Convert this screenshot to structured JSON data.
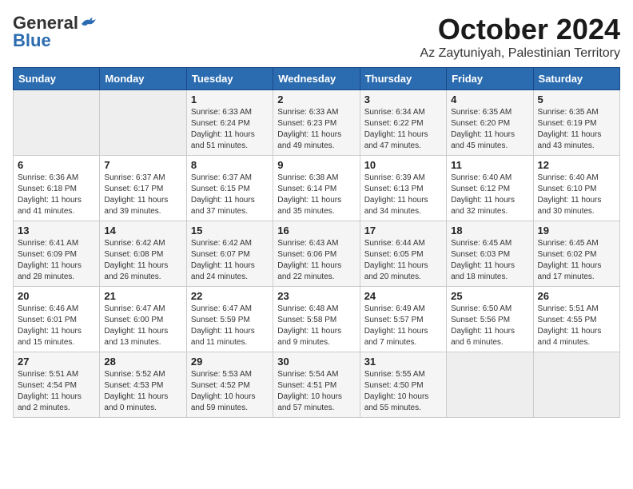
{
  "logo": {
    "general": "General",
    "blue": "Blue"
  },
  "title": "October 2024",
  "location": "Az Zaytuniyah, Palestinian Territory",
  "days_of_week": [
    "Sunday",
    "Monday",
    "Tuesday",
    "Wednesday",
    "Thursday",
    "Friday",
    "Saturday"
  ],
  "weeks": [
    [
      {
        "day": "",
        "empty": true
      },
      {
        "day": "",
        "empty": true
      },
      {
        "day": "1",
        "sunrise": "Sunrise: 6:33 AM",
        "sunset": "Sunset: 6:24 PM",
        "daylight": "Daylight: 11 hours and 51 minutes."
      },
      {
        "day": "2",
        "sunrise": "Sunrise: 6:33 AM",
        "sunset": "Sunset: 6:23 PM",
        "daylight": "Daylight: 11 hours and 49 minutes."
      },
      {
        "day": "3",
        "sunrise": "Sunrise: 6:34 AM",
        "sunset": "Sunset: 6:22 PM",
        "daylight": "Daylight: 11 hours and 47 minutes."
      },
      {
        "day": "4",
        "sunrise": "Sunrise: 6:35 AM",
        "sunset": "Sunset: 6:20 PM",
        "daylight": "Daylight: 11 hours and 45 minutes."
      },
      {
        "day": "5",
        "sunrise": "Sunrise: 6:35 AM",
        "sunset": "Sunset: 6:19 PM",
        "daylight": "Daylight: 11 hours and 43 minutes."
      }
    ],
    [
      {
        "day": "6",
        "sunrise": "Sunrise: 6:36 AM",
        "sunset": "Sunset: 6:18 PM",
        "daylight": "Daylight: 11 hours and 41 minutes."
      },
      {
        "day": "7",
        "sunrise": "Sunrise: 6:37 AM",
        "sunset": "Sunset: 6:17 PM",
        "daylight": "Daylight: 11 hours and 39 minutes."
      },
      {
        "day": "8",
        "sunrise": "Sunrise: 6:37 AM",
        "sunset": "Sunset: 6:15 PM",
        "daylight": "Daylight: 11 hours and 37 minutes."
      },
      {
        "day": "9",
        "sunrise": "Sunrise: 6:38 AM",
        "sunset": "Sunset: 6:14 PM",
        "daylight": "Daylight: 11 hours and 35 minutes."
      },
      {
        "day": "10",
        "sunrise": "Sunrise: 6:39 AM",
        "sunset": "Sunset: 6:13 PM",
        "daylight": "Daylight: 11 hours and 34 minutes."
      },
      {
        "day": "11",
        "sunrise": "Sunrise: 6:40 AM",
        "sunset": "Sunset: 6:12 PM",
        "daylight": "Daylight: 11 hours and 32 minutes."
      },
      {
        "day": "12",
        "sunrise": "Sunrise: 6:40 AM",
        "sunset": "Sunset: 6:10 PM",
        "daylight": "Daylight: 11 hours and 30 minutes."
      }
    ],
    [
      {
        "day": "13",
        "sunrise": "Sunrise: 6:41 AM",
        "sunset": "Sunset: 6:09 PM",
        "daylight": "Daylight: 11 hours and 28 minutes."
      },
      {
        "day": "14",
        "sunrise": "Sunrise: 6:42 AM",
        "sunset": "Sunset: 6:08 PM",
        "daylight": "Daylight: 11 hours and 26 minutes."
      },
      {
        "day": "15",
        "sunrise": "Sunrise: 6:42 AM",
        "sunset": "Sunset: 6:07 PM",
        "daylight": "Daylight: 11 hours and 24 minutes."
      },
      {
        "day": "16",
        "sunrise": "Sunrise: 6:43 AM",
        "sunset": "Sunset: 6:06 PM",
        "daylight": "Daylight: 11 hours and 22 minutes."
      },
      {
        "day": "17",
        "sunrise": "Sunrise: 6:44 AM",
        "sunset": "Sunset: 6:05 PM",
        "daylight": "Daylight: 11 hours and 20 minutes."
      },
      {
        "day": "18",
        "sunrise": "Sunrise: 6:45 AM",
        "sunset": "Sunset: 6:03 PM",
        "daylight": "Daylight: 11 hours and 18 minutes."
      },
      {
        "day": "19",
        "sunrise": "Sunrise: 6:45 AM",
        "sunset": "Sunset: 6:02 PM",
        "daylight": "Daylight: 11 hours and 17 minutes."
      }
    ],
    [
      {
        "day": "20",
        "sunrise": "Sunrise: 6:46 AM",
        "sunset": "Sunset: 6:01 PM",
        "daylight": "Daylight: 11 hours and 15 minutes."
      },
      {
        "day": "21",
        "sunrise": "Sunrise: 6:47 AM",
        "sunset": "Sunset: 6:00 PM",
        "daylight": "Daylight: 11 hours and 13 minutes."
      },
      {
        "day": "22",
        "sunrise": "Sunrise: 6:47 AM",
        "sunset": "Sunset: 5:59 PM",
        "daylight": "Daylight: 11 hours and 11 minutes."
      },
      {
        "day": "23",
        "sunrise": "Sunrise: 6:48 AM",
        "sunset": "Sunset: 5:58 PM",
        "daylight": "Daylight: 11 hours and 9 minutes."
      },
      {
        "day": "24",
        "sunrise": "Sunrise: 6:49 AM",
        "sunset": "Sunset: 5:57 PM",
        "daylight": "Daylight: 11 hours and 7 minutes."
      },
      {
        "day": "25",
        "sunrise": "Sunrise: 6:50 AM",
        "sunset": "Sunset: 5:56 PM",
        "daylight": "Daylight: 11 hours and 6 minutes."
      },
      {
        "day": "26",
        "sunrise": "Sunrise: 5:51 AM",
        "sunset": "Sunset: 4:55 PM",
        "daylight": "Daylight: 11 hours and 4 minutes."
      }
    ],
    [
      {
        "day": "27",
        "sunrise": "Sunrise: 5:51 AM",
        "sunset": "Sunset: 4:54 PM",
        "daylight": "Daylight: 11 hours and 2 minutes."
      },
      {
        "day": "28",
        "sunrise": "Sunrise: 5:52 AM",
        "sunset": "Sunset: 4:53 PM",
        "daylight": "Daylight: 11 hours and 0 minutes."
      },
      {
        "day": "29",
        "sunrise": "Sunrise: 5:53 AM",
        "sunset": "Sunset: 4:52 PM",
        "daylight": "Daylight: 10 hours and 59 minutes."
      },
      {
        "day": "30",
        "sunrise": "Sunrise: 5:54 AM",
        "sunset": "Sunset: 4:51 PM",
        "daylight": "Daylight: 10 hours and 57 minutes."
      },
      {
        "day": "31",
        "sunrise": "Sunrise: 5:55 AM",
        "sunset": "Sunset: 4:50 PM",
        "daylight": "Daylight: 10 hours and 55 minutes."
      },
      {
        "day": "",
        "empty": true
      },
      {
        "day": "",
        "empty": true
      }
    ]
  ]
}
